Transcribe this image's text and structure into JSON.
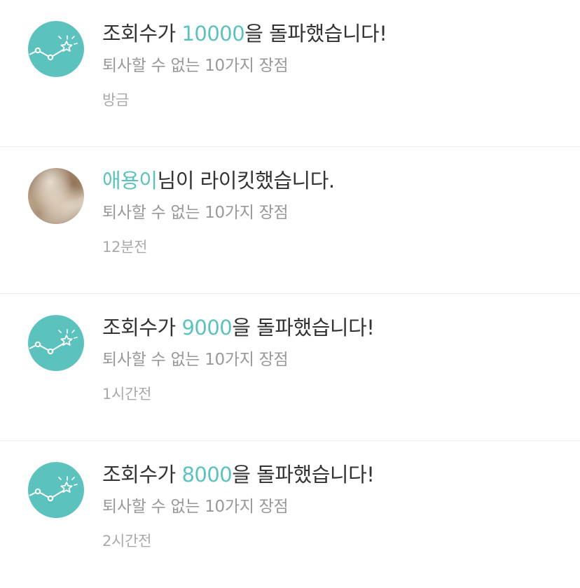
{
  "colors": {
    "accent": "#5cc2bd",
    "title_text": "#333333",
    "subtitle_text": "#999999",
    "time_text": "#aaaaaa"
  },
  "notifications": [
    {
      "avatar_icon": "chart-star-icon",
      "title_prefix": "조회수가 ",
      "title_highlight": "10000",
      "title_suffix": "을 돌파했습니다!",
      "subtitle": "퇴사할 수 없는 10가지 장점",
      "time": "방금"
    },
    {
      "avatar_icon": "user-photo",
      "title_prefix": "",
      "title_highlight": "애용이",
      "title_suffix": "님이 라이킷했습니다.",
      "subtitle": "퇴사할 수 없는 10가지 장점",
      "time": "12분전"
    },
    {
      "avatar_icon": "chart-star-icon",
      "title_prefix": "조회수가 ",
      "title_highlight": "9000",
      "title_suffix": "을 돌파했습니다!",
      "subtitle": "퇴사할 수 없는 10가지 장점",
      "time": "1시간전"
    },
    {
      "avatar_icon": "chart-star-icon",
      "title_prefix": "조회수가 ",
      "title_highlight": "8000",
      "title_suffix": "을 돌파했습니다!",
      "subtitle": "퇴사할 수 없는 10가지 장점",
      "time": "2시간전"
    }
  ]
}
